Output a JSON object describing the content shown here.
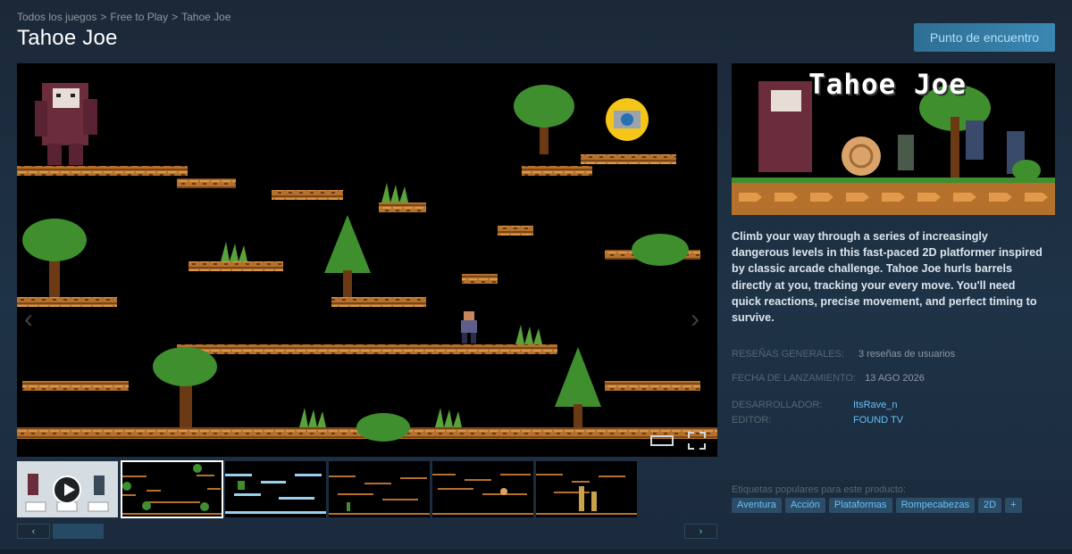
{
  "breadcrumb": {
    "items": [
      "Todos los juegos",
      "Free to Play",
      "Tahoe Joe"
    ],
    "sep": ">"
  },
  "page_title": "Tahoe Joe",
  "community_button": "Punto de encuentro",
  "capsule": {
    "title": "Tahoe Joe"
  },
  "description": "Climb your way through a series of increasingly dangerous levels in this fast-paced 2D platformer inspired by classic arcade challenge. Tahoe Joe hurls barrels directly at you, tracking your every move. You'll need quick reactions, precise movement, and perfect timing to survive.",
  "info": {
    "reviews_label": "RESEÑAS GENERALES:",
    "reviews_value": "3 reseñas de usuarios",
    "release_label": "FECHA DE LANZAMIENTO:",
    "release_value": "13 AGO 2026",
    "developer_label": "DESARROLLADOR:",
    "developer_value": "ItsRave_n",
    "publisher_label": "EDITOR:",
    "publisher_value": "FOUND TV"
  },
  "tags": {
    "label": "Etiquetas populares para este producto:",
    "items": [
      "Aventura",
      "Acción",
      "Plataformas",
      "Rompecabezas",
      "2D",
      "+"
    ]
  },
  "thumb_video": {
    "line1": "JUEGA CONTROLES",
    "btn1": "Mover",
    "btn2": "Saltar",
    "btn3": "Pausa"
  },
  "colors": {
    "accent": "#66c0f4",
    "background": "#1b2838",
    "platform": "#b5712c",
    "tree": "#3f8f2f"
  },
  "icons": {
    "prev": "chevron-left-icon",
    "next": "chevron-right-icon",
    "play": "play-icon",
    "fullscreen": "fullscreen-icon"
  }
}
